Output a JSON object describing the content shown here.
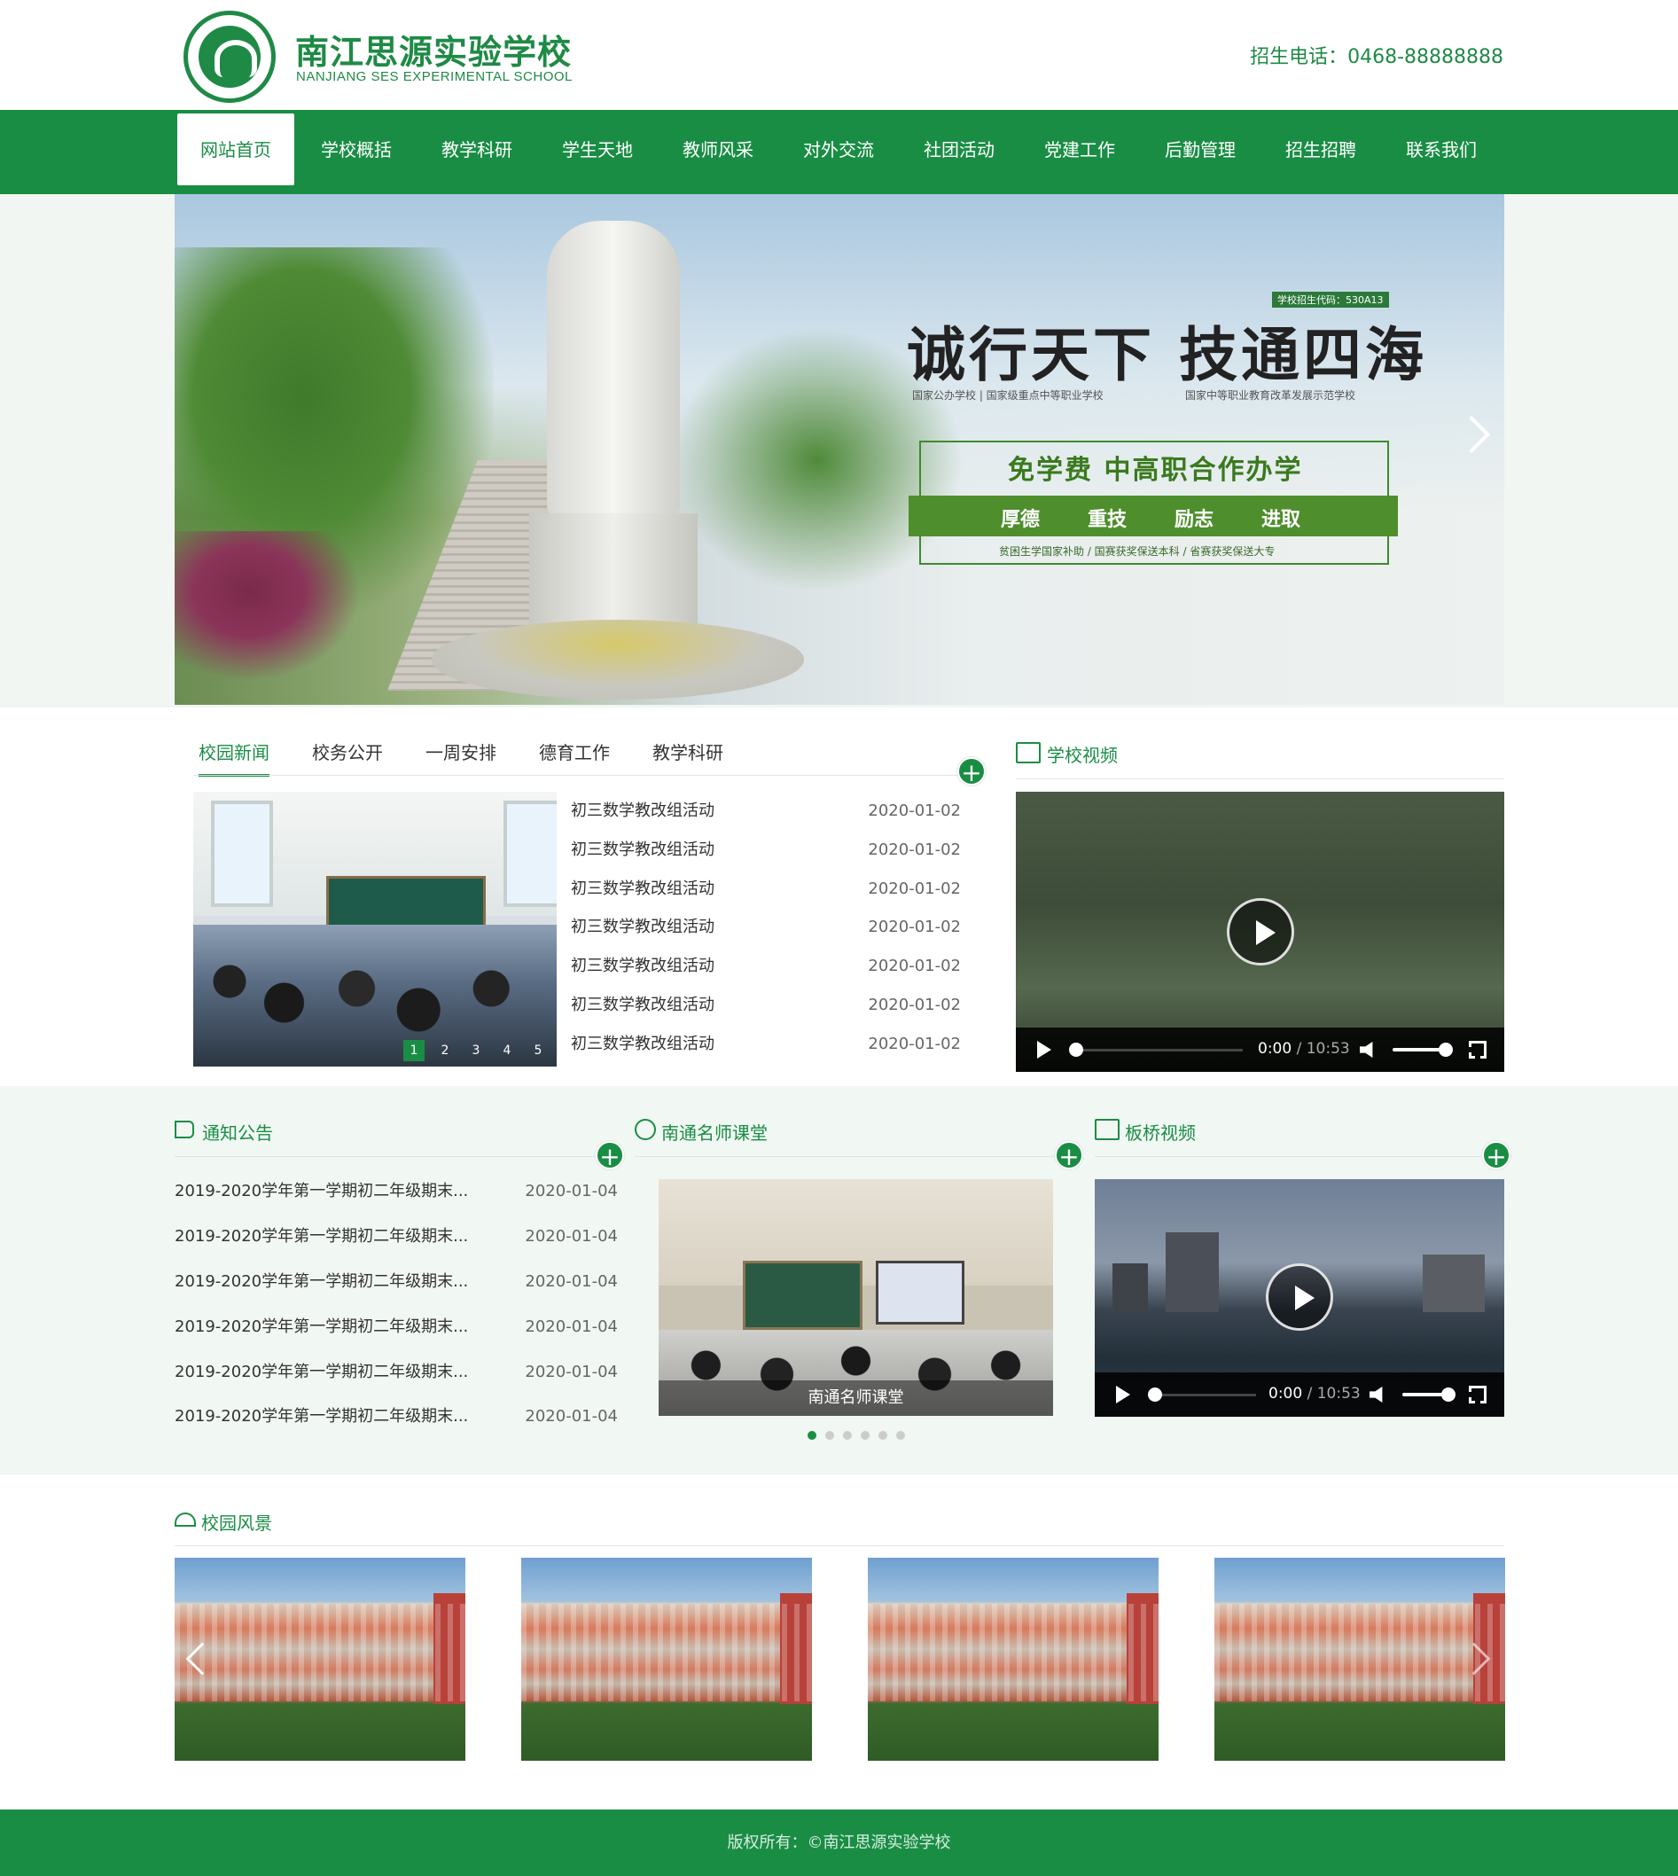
{
  "header": {
    "school_name_cn": "南江思源实验学校",
    "school_name_en": "NANJIANG SES EXPERIMENTAL SCHOOL",
    "hotline": "招生电话：0468-88888888"
  },
  "nav": {
    "items": [
      {
        "label": "网站首页"
      },
      {
        "label": "学校概括"
      },
      {
        "label": "教学科研"
      },
      {
        "label": "学生天地"
      },
      {
        "label": "教师风采"
      },
      {
        "label": "对外交流"
      },
      {
        "label": "社团活动"
      },
      {
        "label": "党建工作"
      },
      {
        "label": "后勤管理"
      },
      {
        "label": "招生招聘"
      },
      {
        "label": "联系我们"
      }
    ],
    "active_index": 0
  },
  "banner": {
    "code": "学校招生代码：530A13",
    "title": "诚行天下 技通四海",
    "sub_left": "国家公办学校 | 国家级重点中等职业学校",
    "sub_right": "国家中等职业教育改革发展示范学校",
    "highlight": "免学费 中高职合作办学",
    "values": [
      "厚德",
      "重技",
      "励志",
      "进取"
    ],
    "footnote": "贫困生学国家补助 / 国赛获奖保送本科 / 省赛获奖保送大专"
  },
  "news": {
    "tabs": [
      "校园新闻",
      "校务公开",
      "一周安排",
      "德育工作",
      "教学科研"
    ],
    "active_tab": 0,
    "more": "+",
    "slider_dots": [
      "1",
      "2",
      "3",
      "4",
      "5"
    ],
    "active_dot": 0,
    "items": [
      {
        "title": "初三数学教改组活动",
        "date": "2020-01-02"
      },
      {
        "title": "初三数学教改组活动",
        "date": "2020-01-02"
      },
      {
        "title": "初三数学教改组活动",
        "date": "2020-01-02"
      },
      {
        "title": "初三数学教改组活动",
        "date": "2020-01-02"
      },
      {
        "title": "初三数学教改组活动",
        "date": "2020-01-02"
      },
      {
        "title": "初三数学教改组活动",
        "date": "2020-01-02"
      },
      {
        "title": "初三数学教改组活动",
        "date": "2020-01-02"
      }
    ]
  },
  "school_video": {
    "title": "学校视频",
    "current_time": "0:00",
    "duration": "/ 10:53"
  },
  "notices": {
    "title": "通知公告",
    "more": "+",
    "items": [
      {
        "title": "2019-2020学年第一学期初二年级期末...",
        "date": "2020-01-04"
      },
      {
        "title": "2019-2020学年第一学期初二年级期末...",
        "date": "2020-01-04"
      },
      {
        "title": "2019-2020学年第一学期初二年级期末...",
        "date": "2020-01-04"
      },
      {
        "title": "2019-2020学年第一学期初二年级期末...",
        "date": "2020-01-04"
      },
      {
        "title": "2019-2020学年第一学期初二年级期末...",
        "date": "2020-01-04"
      },
      {
        "title": "2019-2020学年第一学期初二年级期末...",
        "date": "2020-01-04"
      }
    ]
  },
  "teachers": {
    "title": "南通名师课堂",
    "more": "+",
    "caption": "南通名师课堂",
    "page_count": 6,
    "active_page": 0
  },
  "qiao_video": {
    "title": "板桥视频",
    "more": "+",
    "current_time": "0:00",
    "duration": "/ 10:53"
  },
  "campus": {
    "title": "校园风景",
    "image_count": 4
  },
  "footer": {
    "copyright": "版权所有：©南江思源实验学校"
  },
  "colors": {
    "brand_green": "#1a8d45",
    "mid_background": "#f1f7f3"
  }
}
